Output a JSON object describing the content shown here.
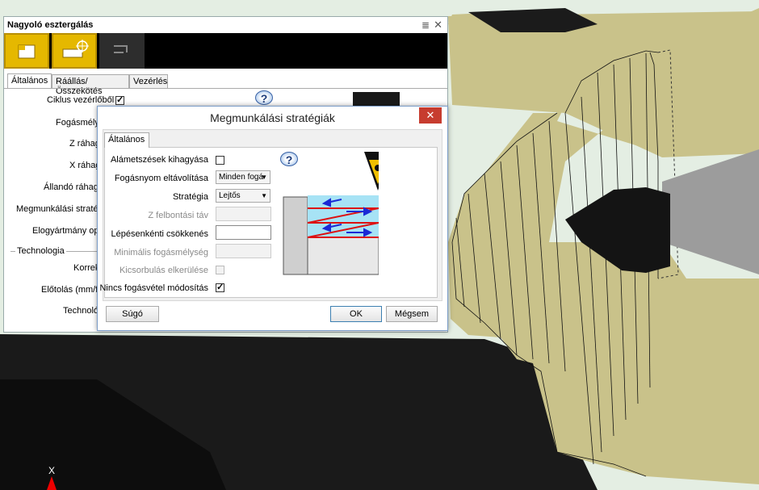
{
  "panel": {
    "title": "Nagyoló esztergálás",
    "pin_icon": "≣",
    "close_icon": "✕",
    "toolbar": [
      "part-icon",
      "tool-icon",
      "link-icon"
    ],
    "tabs": [
      "Általános",
      "Ráállás/Összekötés",
      "Vezérlés"
    ],
    "fields": {
      "ciklus": "Ciklus vezérlőből",
      "fogasmely": "Fogásmélys",
      "z_rahagy": "Z ráhag",
      "x_rahagy": "X ráhag",
      "allando": "Állandó ráhag",
      "strategia": "Megmunkálási stratég",
      "elogyartmany": "Elogyártmány opc",
      "technologia_group": "Technologia",
      "korrek": "Korrek",
      "elotolas": "Előtolás (mm/fo",
      "technolo": "Technoló"
    }
  },
  "dialog": {
    "title": "Megmunkálási stratégiák",
    "close_icon": "✕",
    "tab": "Általános",
    "fields": {
      "alametszesek": "Alámetszések kihagyása",
      "fogasnyom": "Fogásnyom eltávolítása",
      "fogasnyom_value": "Minden fogá",
      "strategia": "Stratégia",
      "strategia_value": "Lejtős",
      "z_felbontasi": "Z felbontási táv",
      "lepesenkenti": "Lépésenkénti csökkenés",
      "minimalis": "Minimális fogásmélység",
      "kicsorbulas": "Kicsorbulás elkerülése",
      "nincs": "Nincs fogásvétel módosítás"
    },
    "help_icon": "?",
    "buttons": {
      "help": "Súgó",
      "ok": "OK",
      "cancel": "Mégsem"
    }
  },
  "viewport": {
    "axis_label": "X"
  },
  "colors": {
    "accent": "#e5b800",
    "part": "#c9c28a",
    "close": "#c73c2f"
  }
}
